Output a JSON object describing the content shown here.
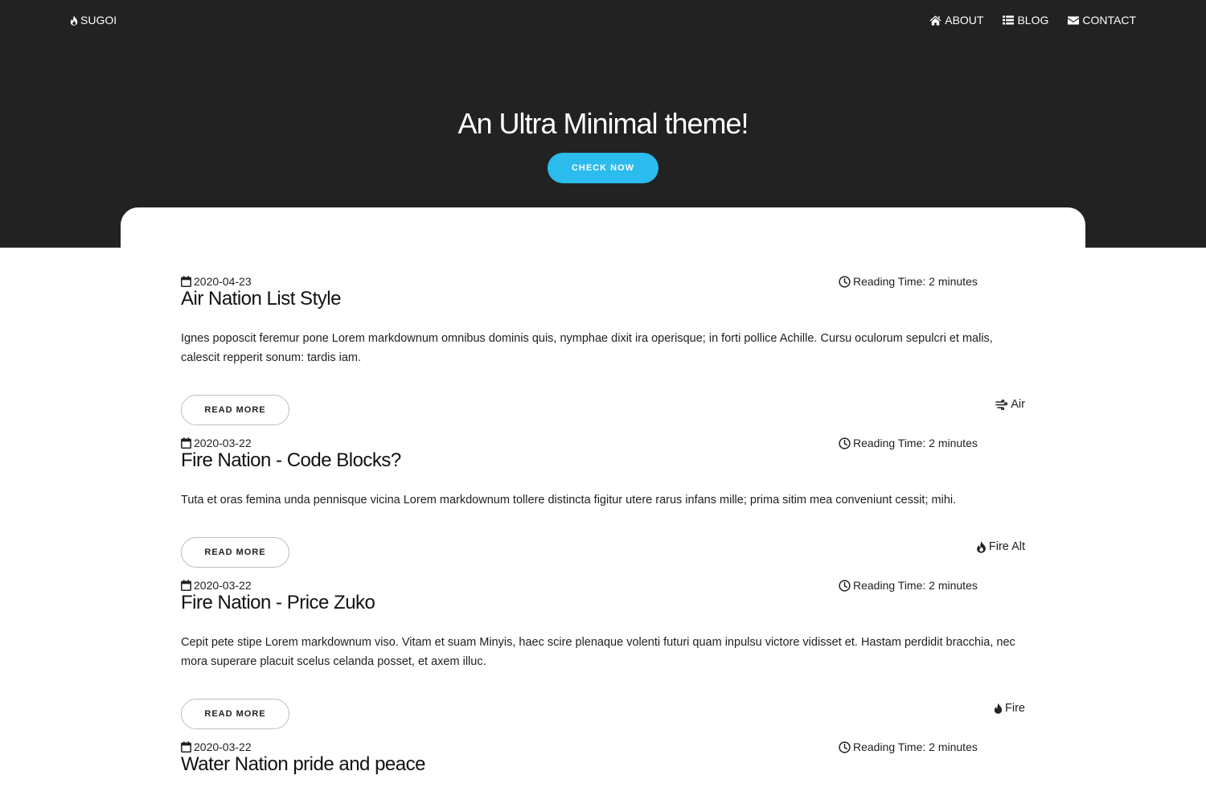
{
  "navbar": {
    "brand": {
      "label": "SUGOI",
      "icon": "fire-icon"
    },
    "links": [
      {
        "label": "ABOUT",
        "icon": "home-icon"
      },
      {
        "label": "BLOG",
        "icon": "list-icon"
      },
      {
        "label": "CONTACT",
        "icon": "envelope-icon"
      }
    ]
  },
  "hero": {
    "title": "An Ultra Minimal theme!",
    "cta_label": "CHECK NOW"
  },
  "colors": {
    "hero_background": "#222222",
    "accent": "#2bbbed",
    "text": "#212121"
  },
  "posts": [
    {
      "date": "2020-04-23",
      "reading_time": "Reading Time: 2 minutes",
      "title": "Air Nation List Style",
      "excerpt": "Ignes poposcit feremur pone Lorem markdownum omnibus dominis quis, nymphae dixit ira operisque; in forti pollice Achille. Cursu oculorum sepulcri et malis, calescit repperit sonum: tardis iam.",
      "read_more": "READ MORE",
      "tag": "Air",
      "tag_icon": "wind-icon"
    },
    {
      "date": "2020-03-22",
      "reading_time": "Reading Time: 2 minutes",
      "title": "Fire Nation - Code Blocks?",
      "excerpt": "Tuta et oras femina unda pennisque vicina Lorem markdownum tollere distincta figitur utere rarus infans mille; prima sitim mea conveniunt cessit; mihi.",
      "read_more": "READ MORE",
      "tag": "Fire Alt",
      "tag_icon": "fire-alt-icon"
    },
    {
      "date": "2020-03-22",
      "reading_time": "Reading Time: 2 minutes",
      "title": "Fire Nation - Price Zuko",
      "excerpt": "Cepit pete stipe Lorem markdownum viso. Vitam et suam Minyis, haec scire plenaque volenti futuri quam inpulsu victore vidisset et. Hastam perdidit bracchia, nec mora superare placuit scelus celanda posset, et axem illuc.",
      "read_more": "READ MORE",
      "tag": "Fire",
      "tag_icon": "fire-icon"
    },
    {
      "date": "2020-03-22",
      "reading_time": "Reading Time: 2 minutes",
      "title": "Water Nation pride and peace"
    }
  ]
}
